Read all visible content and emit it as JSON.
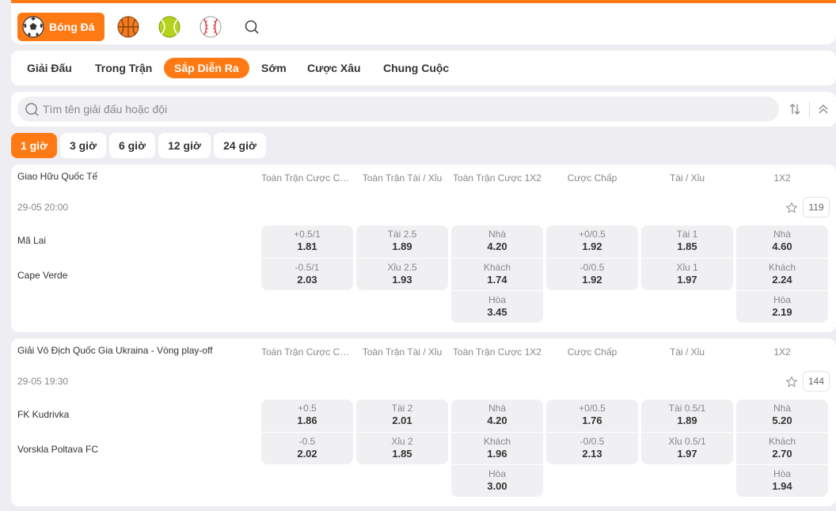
{
  "sports": {
    "active_label": "Bóng Đá",
    "items": [
      "soccer-ball-icon",
      "basketball-icon",
      "tennis-ball-icon",
      "baseball-icon",
      "search-icon"
    ]
  },
  "tabs": [
    "Giải Đấu",
    "Trong Trận",
    "Sắp Diễn Ra",
    "Sớm",
    "Cược Xâu",
    "Chung Cuộc"
  ],
  "active_tab": "Sắp Diễn Ra",
  "search": {
    "placeholder": "Tìm tên giải đấu hoặc đội"
  },
  "time_filters": [
    "1 giờ",
    "3 giờ",
    "6 giờ",
    "12 giờ",
    "24 giờ"
  ],
  "active_time_filter": "1 giờ",
  "colors": {
    "accent": "#ff7a14",
    "cell_bg": "#f0f0f3"
  },
  "leagues": [
    {
      "name": "Giao Hữu Quốc Tế",
      "columns": [
        "Toàn Trận Cược Chấp",
        "Toàn Trận Tài / Xỉu",
        "Toàn Trận Cược 1X2",
        "Cược Chấp",
        "Tài / Xỉu",
        "1X2"
      ],
      "datetime": "29-05  20:00",
      "market_count": "119",
      "home": "Mã Lai",
      "away": "Cape Verde",
      "markets": [
        [
          {
            "label": "+0.5/1",
            "odds": "1.81"
          },
          {
            "label": "-0.5/1",
            "odds": "2.03"
          }
        ],
        [
          {
            "label": "Tài 2.5",
            "odds": "1.89"
          },
          {
            "label": "Xỉu 2.5",
            "odds": "1.93"
          }
        ],
        [
          {
            "label": "Nhà",
            "odds": "4.20"
          },
          {
            "label": "Khách",
            "odds": "1.74"
          },
          {
            "label": "Hòa",
            "odds": "3.45"
          }
        ],
        [
          {
            "label": "+0/0.5",
            "odds": "1.92"
          },
          {
            "label": "-0/0.5",
            "odds": "1.92"
          }
        ],
        [
          {
            "label": "Tài 1",
            "odds": "1.85"
          },
          {
            "label": "Xỉu 1",
            "odds": "1.97"
          }
        ],
        [
          {
            "label": "Nhà",
            "odds": "4.60"
          },
          {
            "label": "Khách",
            "odds": "2.24"
          },
          {
            "label": "Hòa",
            "odds": "2.19"
          }
        ]
      ]
    },
    {
      "name": "Giải Vô Địch Quốc Gia Ukraina - Vòng play-off",
      "columns": [
        "Toàn Trận Cược Chấp",
        "Toàn Trận Tài / Xỉu",
        "Toàn Trận Cược 1X2",
        "Cược Chấp",
        "Tài / Xỉu",
        "1X2"
      ],
      "datetime": "29-05  19:30",
      "market_count": "144",
      "home": "FK Kudrivka",
      "away": "Vorskla Poltava FC",
      "markets": [
        [
          {
            "label": "+0.5",
            "odds": "1.86"
          },
          {
            "label": "-0.5",
            "odds": "2.02"
          }
        ],
        [
          {
            "label": "Tài 2",
            "odds": "2.01"
          },
          {
            "label": "Xỉu 2",
            "odds": "1.85"
          }
        ],
        [
          {
            "label": "Nhà",
            "odds": "4.20"
          },
          {
            "label": "Khách",
            "odds": "1.96"
          },
          {
            "label": "Hòa",
            "odds": "3.00"
          }
        ],
        [
          {
            "label": "+0/0.5",
            "odds": "1.76"
          },
          {
            "label": "-0/0.5",
            "odds": "2.13"
          }
        ],
        [
          {
            "label": "Tài 0.5/1",
            "odds": "1.89"
          },
          {
            "label": "Xỉu 0.5/1",
            "odds": "1.97"
          }
        ],
        [
          {
            "label": "Nhà",
            "odds": "5.20"
          },
          {
            "label": "Khách",
            "odds": "2.70"
          },
          {
            "label": "Hòa",
            "odds": "1.94"
          }
        ]
      ]
    }
  ]
}
